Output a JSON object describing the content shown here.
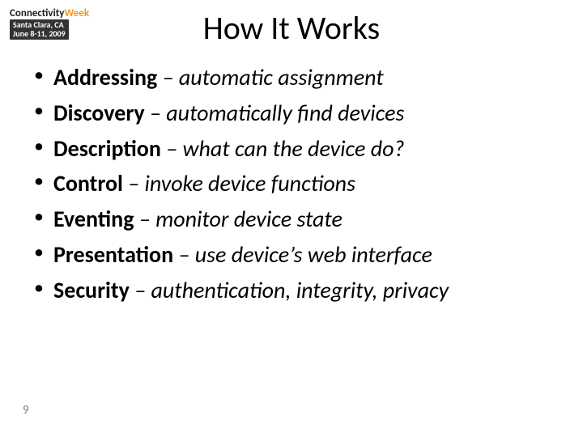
{
  "logo": {
    "brand_prefix": "Connectivity",
    "brand_suffix": "Week",
    "location": "Santa Clara, CA",
    "dates": "June 8-11, 2009"
  },
  "title": "How It Works",
  "bullets": [
    {
      "term": "Addressing",
      "desc": "automatic assignment"
    },
    {
      "term": "Discovery",
      "desc": "automatically find devices"
    },
    {
      "term": "Description",
      "desc": "what can the device do?"
    },
    {
      "term": "Control",
      "desc": "invoke device functions"
    },
    {
      "term": "Eventing",
      "desc": "monitor device state"
    },
    {
      "term": "Presentation",
      "desc": "use device’s web interface"
    },
    {
      "term": "Security",
      "desc": "authentication, integrity, privacy"
    }
  ],
  "dash": " – ",
  "page_number": "9"
}
